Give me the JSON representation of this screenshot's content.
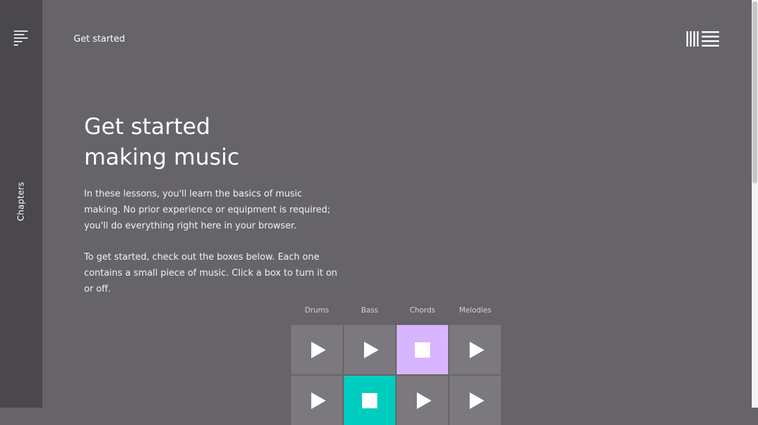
{
  "sidebar": {
    "menu_icon": "menu-icon",
    "chapters_label": "Chapters"
  },
  "header": {
    "title": "Get started",
    "logo_icon": "ableton-logo-icon"
  },
  "main": {
    "heading_line1": "Get started",
    "heading_line2": "making music",
    "paragraph1": "In these lessons, you'll learn the basics of music making. No prior experience or equipment is required; you'll do everything right here in your browser.",
    "paragraph2": "To get started, check out the boxes below. Each one contains a small piece of music. Click a box to turn it on or off."
  },
  "grid": {
    "columns": [
      "Drums",
      "Bass",
      "Chords",
      "Melodies"
    ],
    "rows": [
      [
        {
          "state": "off",
          "icon": "play-icon"
        },
        {
          "state": "off",
          "icon": "play-icon"
        },
        {
          "state": "on",
          "icon": "stop-icon",
          "color": "#d7b5ff"
        },
        {
          "state": "off",
          "icon": "play-icon"
        }
      ],
      [
        {
          "state": "off",
          "icon": "play-icon"
        },
        {
          "state": "on",
          "icon": "stop-icon",
          "color": "#00cdbf"
        },
        {
          "state": "off",
          "icon": "play-icon"
        },
        {
          "state": "off",
          "icon": "play-icon"
        }
      ]
    ]
  },
  "colors": {
    "background": "#666468",
    "sidebar": "#4a484c",
    "pad_off": "#7b797d",
    "chords_on": "#d7b5ff",
    "bass_on": "#00cdbf"
  }
}
